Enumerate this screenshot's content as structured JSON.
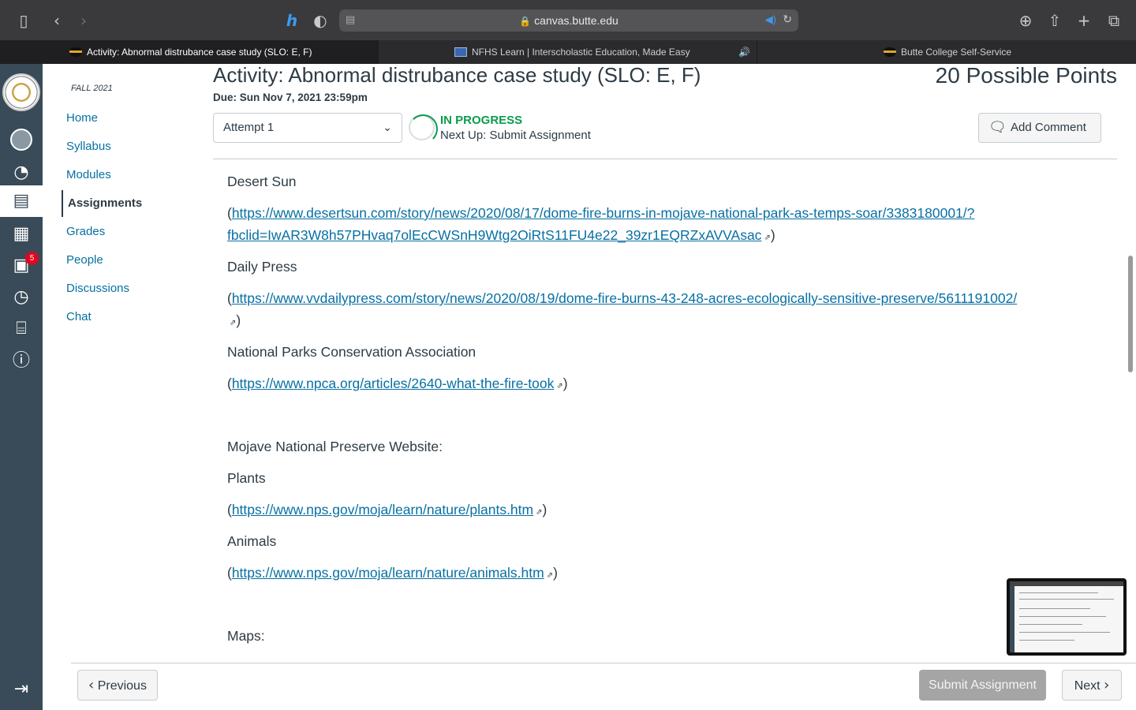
{
  "browser": {
    "url": "canvas.butte.edu",
    "tabs": [
      {
        "label": "Activity: Abnormal distrubance case study (SLO: E, F)",
        "active": true
      },
      {
        "label": "NFHS Learn | Interscholastic Education, Made Easy",
        "active": false
      },
      {
        "label": "Butte College Self-Service",
        "active": false
      }
    ]
  },
  "course_nav": {
    "term": "FALL 2021",
    "items": [
      {
        "label": "Home"
      },
      {
        "label": "Syllabus"
      },
      {
        "label": "Modules"
      },
      {
        "label": "Assignments",
        "active": true
      },
      {
        "label": "Grades"
      },
      {
        "label": "People"
      },
      {
        "label": "Discussions"
      },
      {
        "label": "Chat"
      }
    ]
  },
  "global_nav": {
    "inbox_badge": "5"
  },
  "assignment": {
    "title": "Activity: Abnormal distrubance case study (SLO: E, F)",
    "points": "20 Possible Points",
    "due": "Due: Sun Nov 7, 2021 23:59pm",
    "attempt": "Attempt 1",
    "status": "IN PROGRESS",
    "next_up": "Next Up: Submit Assignment",
    "add_comment": "Add Comment"
  },
  "content": {
    "desert_sun": "Desert Sun",
    "desert_sun_link_1": "https://www.desertsun.com/story/news/2020/08/17/dome-fire-burns-in-mojave-national-park-as-temps-soar/3383180001/?",
    "desert_sun_link_2": "fbclid=IwAR3W8h57PHvaq7olEcCWSnH9Wtg2OiRtS11FU4e22_39zr1EQRZxAVVAsac",
    "daily_press": "Daily Press",
    "daily_press_link": "https://www.vvdailypress.com/story/news/2020/08/19/dome-fire-burns-43-248-acres-ecologically-sensitive-preserve/5611191002/",
    "npca": "National Parks Conservation Association",
    "npca_link": "https://www.npca.org/articles/2640-what-the-fire-took",
    "mojave_heading": "Mojave National Preserve Website:",
    "plants": "Plants",
    "plants_link": "https://www.nps.gov/moja/learn/nature/plants.htm",
    "animals": "Animals",
    "animals_link": "https://www.nps.gov/moja/learn/nature/animals.htm",
    "maps": "Maps:"
  },
  "footer": {
    "previous": "Previous",
    "submit": "Submit Assignment",
    "next": "Next"
  }
}
